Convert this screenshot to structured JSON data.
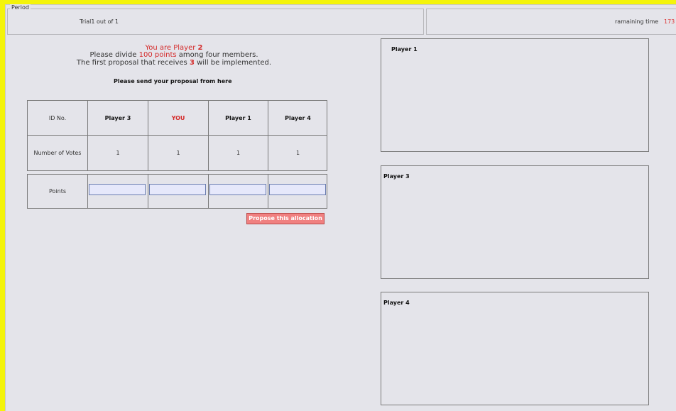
{
  "period": {
    "legend": "Period",
    "trial_text": "Trial1  out of  1"
  },
  "timer": {
    "label": "ramaining time",
    "value": "173"
  },
  "instructions": {
    "line1_prefix": "You are Player ",
    "line1_num": "2",
    "line2_prefix": "Please divide ",
    "line2_points": "100 points",
    "line2_suffix": " among four members.",
    "line3_prefix": "The first proposal that receives ",
    "line3_num": "3",
    "line3_suffix": " will be implemented."
  },
  "send_text": "Please send your proposal from here",
  "table": {
    "id_header": "ID No.",
    "columns": [
      "Player 3",
      "YOU",
      "Player 1",
      "Player 4"
    ],
    "votes_label": "Number of Votes",
    "votes": [
      "1",
      "1",
      "1",
      "1"
    ],
    "points_label": "Points",
    "points_values": [
      "",
      "",
      "",
      ""
    ]
  },
  "propose_button": "Propose this allocation",
  "panels": [
    "Player 1",
    "Player 3",
    "Player 4"
  ],
  "colors": {
    "accent_red": "#d42b2b",
    "button_bg": "#f08080",
    "background_yellow": "#f4f40a",
    "panel_bg": "#e4e4ea",
    "input_bg": "#e6e8fb"
  }
}
